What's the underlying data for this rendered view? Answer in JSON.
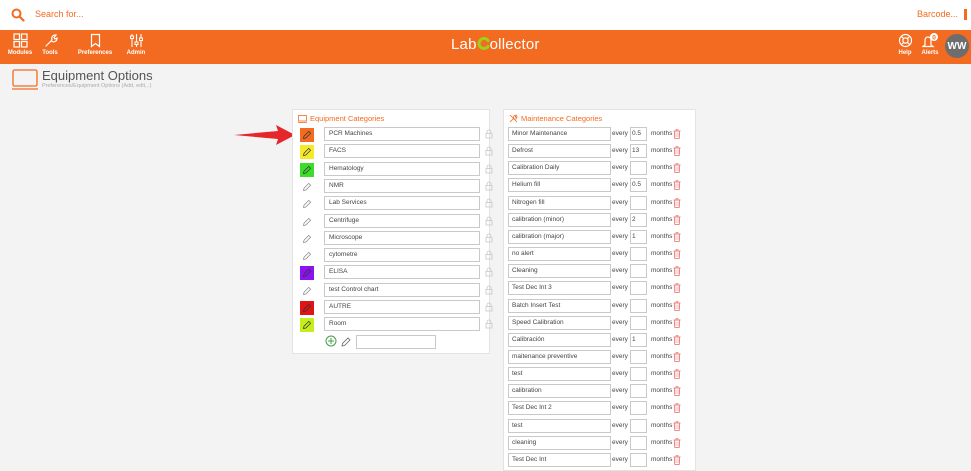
{
  "search": {
    "placeholder": "Search for...",
    "barcode_label": "Barcode..."
  },
  "nav": {
    "modules": "Modules",
    "tools": "Tools",
    "preferences": "Preferences",
    "admin": "Admin",
    "logo_prefix": "Lab",
    "logo_suffix": "ollector",
    "help": "Help",
    "alerts": "Alerts",
    "alerts_count": "0",
    "avatar": "WW"
  },
  "header": {
    "title": "Equipment Options",
    "breadcrumb": "Preferences/Equipment Options (Add, edit,..)"
  },
  "equipment_categories": {
    "title": "Equipment Categories",
    "items": [
      {
        "name": "PCR Machines",
        "color": "#f26b21"
      },
      {
        "name": "FACS",
        "color": "#f5ea2a"
      },
      {
        "name": "Hematology",
        "color": "#3ddc2b"
      },
      {
        "name": "NMR",
        "color": ""
      },
      {
        "name": "Lab Services",
        "color": ""
      },
      {
        "name": "Centrifuge",
        "color": ""
      },
      {
        "name": "Microscope",
        "color": ""
      },
      {
        "name": "cytometre",
        "color": ""
      },
      {
        "name": "ELISA",
        "color": "#8a14ee"
      },
      {
        "name": "test Control chart",
        "color": ""
      },
      {
        "name": "AUTRE",
        "color": "#e01414"
      },
      {
        "name": "Room",
        "color": "#c6ed1c"
      }
    ]
  },
  "maintenance_categories": {
    "title": "Maintenance Categories",
    "every_label": "every",
    "months_label": "months",
    "items": [
      {
        "name": "Minor Maintenance",
        "every": "0.5"
      },
      {
        "name": "Defrost",
        "every": "13"
      },
      {
        "name": "Calibration Daily",
        "every": ""
      },
      {
        "name": "Helium fill",
        "every": "0.5"
      },
      {
        "name": "Nitrogen fill",
        "every": ""
      },
      {
        "name": "calibration (minor)",
        "every": "2"
      },
      {
        "name": "calibration (major)",
        "every": "1"
      },
      {
        "name": "no alert",
        "every": ""
      },
      {
        "name": "Cleaning",
        "every": ""
      },
      {
        "name": "Test Dec Int 3",
        "every": ""
      },
      {
        "name": "Batch Insert Test",
        "every": ""
      },
      {
        "name": "Speed Calibration",
        "every": ""
      },
      {
        "name": "Calibración",
        "every": "1"
      },
      {
        "name": "maitenance preventive",
        "every": ""
      },
      {
        "name": "test",
        "every": ""
      },
      {
        "name": "calibration",
        "every": ""
      },
      {
        "name": "Test Dec Int 2",
        "every": ""
      },
      {
        "name": "test",
        "every": ""
      },
      {
        "name": "cleaning",
        "every": ""
      },
      {
        "name": "Test Dec Int",
        "every": ""
      }
    ]
  },
  "colors": {
    "accent": "#f26b21",
    "pointer_arrow": "#e5262b"
  }
}
